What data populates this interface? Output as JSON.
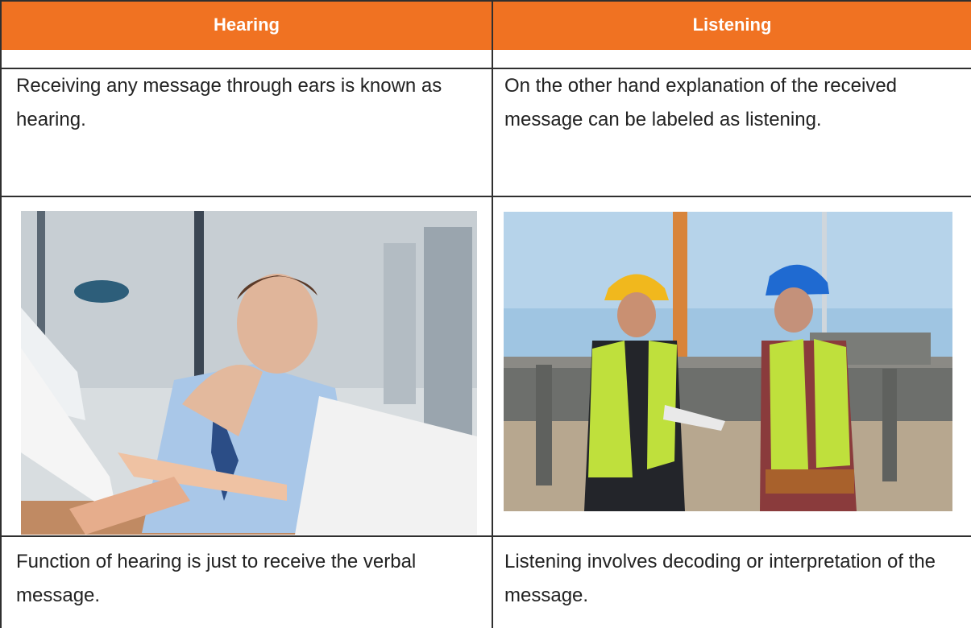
{
  "table": {
    "headers": [
      "Hearing",
      "Listening"
    ],
    "rows": [
      {
        "hearing": "Receiving any message through ears is known as hearing.",
        "listening": "On the other hand explanation of the received message can be labeled as listening."
      },
      {
        "hearing": "Function of hearing is just to receive the verbal message.",
        "listening": "Listening involves decoding or interpretation of the message."
      }
    ]
  },
  "colors": {
    "header_bg": "#f07222",
    "header_text": "#ffffff",
    "border": "#2f2f2f",
    "text": "#222222"
  }
}
